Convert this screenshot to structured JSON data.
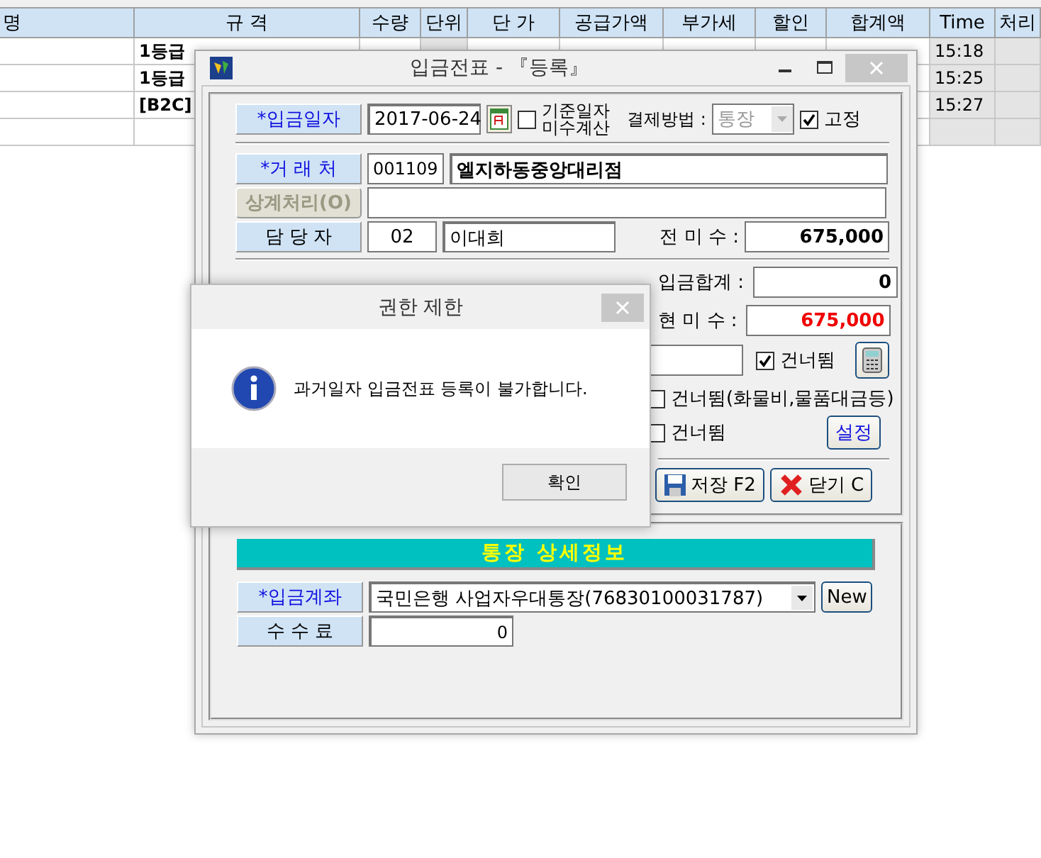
{
  "background_table": {
    "columns": [
      "명",
      "규 격",
      "수량",
      "단위",
      "단 가",
      "공급가액",
      "부가세",
      "할인",
      "합계액",
      "Time",
      "처리"
    ],
    "rows": [
      {
        "spec": "1등급",
        "time": "15:18"
      },
      {
        "spec": "1등급",
        "time": "15:25"
      },
      {
        "spec": "[B2C]",
        "time": "15:27"
      },
      {}
    ]
  },
  "dialog": {
    "title": "입금전표 - 『등록』",
    "date": {
      "label": "*입금일자",
      "value": "2017-06-24"
    },
    "exclude_check": {
      "label": "기준일자\n미수계산",
      "checked": false
    },
    "payment_method": {
      "label": "결제방법 :",
      "value": "통장",
      "disabled": true
    },
    "fixed_check": {
      "label": "고정",
      "checked": true
    },
    "client": {
      "label": "*거 래 처",
      "code": "001109",
      "name": "엘지하동중앙대리점"
    },
    "offset": {
      "label": "상계처리(O)",
      "disabled": true
    },
    "manager": {
      "label": "담 당 자",
      "code": "02",
      "name": "이대희"
    },
    "prev_balance": {
      "label": "전 미 수 :",
      "value": "675,000"
    },
    "deposit_total": {
      "label": "입금합계 :",
      "value": "0"
    },
    "current_balance": {
      "label": "현 미 수 :",
      "value": "675,000"
    },
    "skip_checks": [
      {
        "label": "건너뜀",
        "checked": true
      },
      {
        "label": "건너뜀(화물비,물품대금등)",
        "checked": false
      },
      {
        "label": "건너뜀",
        "checked": false
      }
    ],
    "settings_button": "설정",
    "save_button": "저장 F2",
    "close_button": "닫기 C",
    "bank_section": {
      "title": "통장 상세정보",
      "account": {
        "label": "*입금계좌",
        "value": "국민은행 사업자우대통장(76830100031787)"
      },
      "new_button": "New",
      "fee": {
        "label": "수 수 료",
        "value": "0"
      }
    }
  },
  "alert": {
    "title": "권한 제한",
    "message": "과거일자 입금전표 등록이 불가합니다.",
    "ok_button": "확인"
  }
}
